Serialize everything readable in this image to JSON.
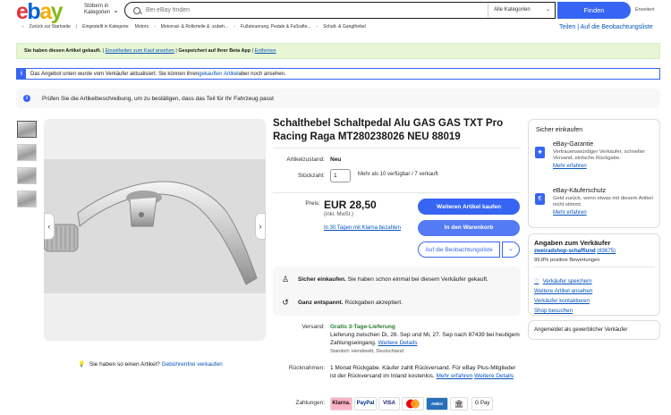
{
  "header": {
    "logo": [
      "e",
      "b",
      "a",
      "y"
    ],
    "browse_label": "Stöbern in Kategorien",
    "search_placeholder": "Bei eBay finden",
    "category_select": "Alle Kategorien",
    "search_button": "Finden",
    "advanced": "Erweitert"
  },
  "breadcrumb": {
    "back": "Zurück zur Startseite",
    "in_label": "Eingestellt in Kategorie:",
    "items": [
      "Motors",
      "Motorrad- & Rollerteile & -zubeh...",
      "Fußsteuerung, Pedale & Fußrafte...",
      "Schalt- & Gangthebel"
    ],
    "share": "Teilen",
    "watchlist": "Auf die Beobachtungsliste"
  },
  "banners": {
    "viewed": {
      "text": "Sie haben diesen Artikel gekauft.",
      "link": "Einzelheiten zum Kauf ansehen",
      "saved": "Gespeichert auf Ihrer Beta App",
      "more": "Entfernen"
    },
    "updated": {
      "icon": "i",
      "text1": "Das Angebot unten wurde vom Verkäufer aktualisiert. Sie können ihren ",
      "link": "gekauften Artikel",
      "text2": " aber noch ansehen."
    },
    "compat": {
      "icon": "i",
      "text": "Prüfen Sie die Artikelbeschreibung, um zu bestätigen, dass das Teil für Ihr Fahrzeug passt"
    }
  },
  "gallery": {
    "thumb_count": 4,
    "prev_icon": "chevron-left-icon",
    "next_icon": "chevron-right-icon",
    "sell_hint": "Sie haben so einen Artikel?",
    "sell_link": "Gebührenfrei verkaufen"
  },
  "item": {
    "title": "Schalthebel Schaltpedal Alu GAS GAS TXT Pro Racing Raga MT280238026 NEU 88019",
    "condition_label": "Artikelzustand:",
    "condition": "Neu",
    "qty_label": "Stückzahl:",
    "qty": "1",
    "availability": "Mehr als 10 verfügbar / 7 verkauft",
    "price_label": "Preis:",
    "price": "EUR 28,50",
    "price_note": "(inkl. MwSt.)",
    "klarna": "In 30 Tagen mit Klarna bezahlen",
    "buy_now": "Weiteren Artikel kaufen",
    "add_to_cart": "In den Warenkorb",
    "watch": "Auf die Beobachtungsliste",
    "trust1_bold": "Sicher einkaufen.",
    "trust1": " Sie haben schon einmal bei diesem Verkäufer gekauft.",
    "trust2_bold": "Ganz entspannt.",
    "trust2": " Rückgaben akzeptiert.",
    "shipping_label": "Versand:",
    "shipping_title": "Gratis 3-Tage-Lieferung",
    "shipping_detail": "Lieferung zwischen Di, 26. Sep und Mi, 27. Sep nach 87439 bei heutigem Zahlungseingang.",
    "shipping_link": "Weitere Details",
    "shipping_location": "Standort: Hendewitt, Deutschland",
    "returns_label": "Rücknahmen:",
    "returns_text": "1 Monat Rückgabe. Käufer zahlt Rückversand. Für eBay Plus-Mitglieder ist der Rückversand im Inland kostenlos.",
    "returns_more": "Mehr erfahren",
    "returns_link": "Weitere Details",
    "payments_label": "Zahlungen:",
    "payments": [
      "Klarna.",
      "PayPal",
      "VISA",
      "MC",
      "AMEX",
      "Bank",
      "G Pay"
    ]
  },
  "shop_safely": {
    "heading": "Sicher einkaufen",
    "guarantee_title": "eBay-Garantie",
    "guarantee_text": "Vertrauenswürdiger Verkäufer, schneller Versand, einfache Rückgabe.",
    "guarantee_link": "Mehr erfahren",
    "protection_title": "eBay-Käuferschutz",
    "protection_text": "Geld zurück, wenn etwas mit diesem Artikel nicht stimmt.",
    "protection_link": "Mehr erfahren"
  },
  "seller": {
    "heading": "Angaben zum Verkäufer",
    "name": "zweiradshop-schafflund",
    "score": "(83675)",
    "feedback": "99,8% positive Bewertungen",
    "save": "Verkäufer speichern",
    "more_items": "Weitere Artikel ansehen",
    "contact": "Verkäufer kontaktieren",
    "visit": "Shop besuchen",
    "business": "Angemeldet als gewerblicher Verkäufer"
  },
  "colors": {
    "primary": "#3665f3",
    "success_bg": "#e7f6d5",
    "link": "#0654ba"
  }
}
